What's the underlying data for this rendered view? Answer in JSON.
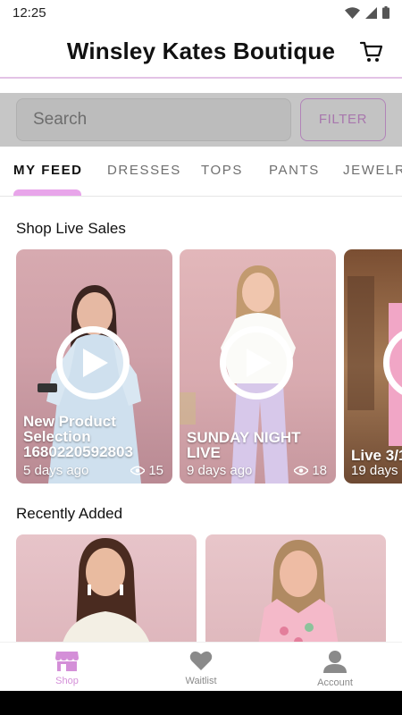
{
  "status_bar": {
    "time": "12:25"
  },
  "header": {
    "title": "Winsley Kates Boutique",
    "cart_icon": "cart-icon"
  },
  "search": {
    "placeholder": "Search",
    "filter_label": "FILTER"
  },
  "tabs": [
    "MY FEED",
    "DRESSES",
    "TOPS",
    "PANTS",
    "JEWELR"
  ],
  "active_tab": "MY FEED",
  "live_section": {
    "title": "Shop Live Sales",
    "cards": [
      {
        "title_line1": "New Product",
        "title_line2": "Selection",
        "title_line3": "1680220592803",
        "time": "5 days ago",
        "views": "15"
      },
      {
        "title_line1": "SUNDAY NIGHT",
        "title_line2": "LIVE",
        "time": "9 days ago",
        "views": "18"
      },
      {
        "title_line1": "Live 3/1",
        "time": "19 days"
      }
    ]
  },
  "recent_section": {
    "title": "Recently Added"
  },
  "bottom_nav": [
    {
      "label": "Shop",
      "icon": "store-icon"
    },
    {
      "label": "Waitlist",
      "icon": "heart-icon"
    },
    {
      "label": "Account",
      "icon": "person-icon"
    }
  ],
  "colors": {
    "accent": "#d48fd8",
    "tab_indicator": "#e8a5ea",
    "search_overlay": "#c6c6c6"
  }
}
